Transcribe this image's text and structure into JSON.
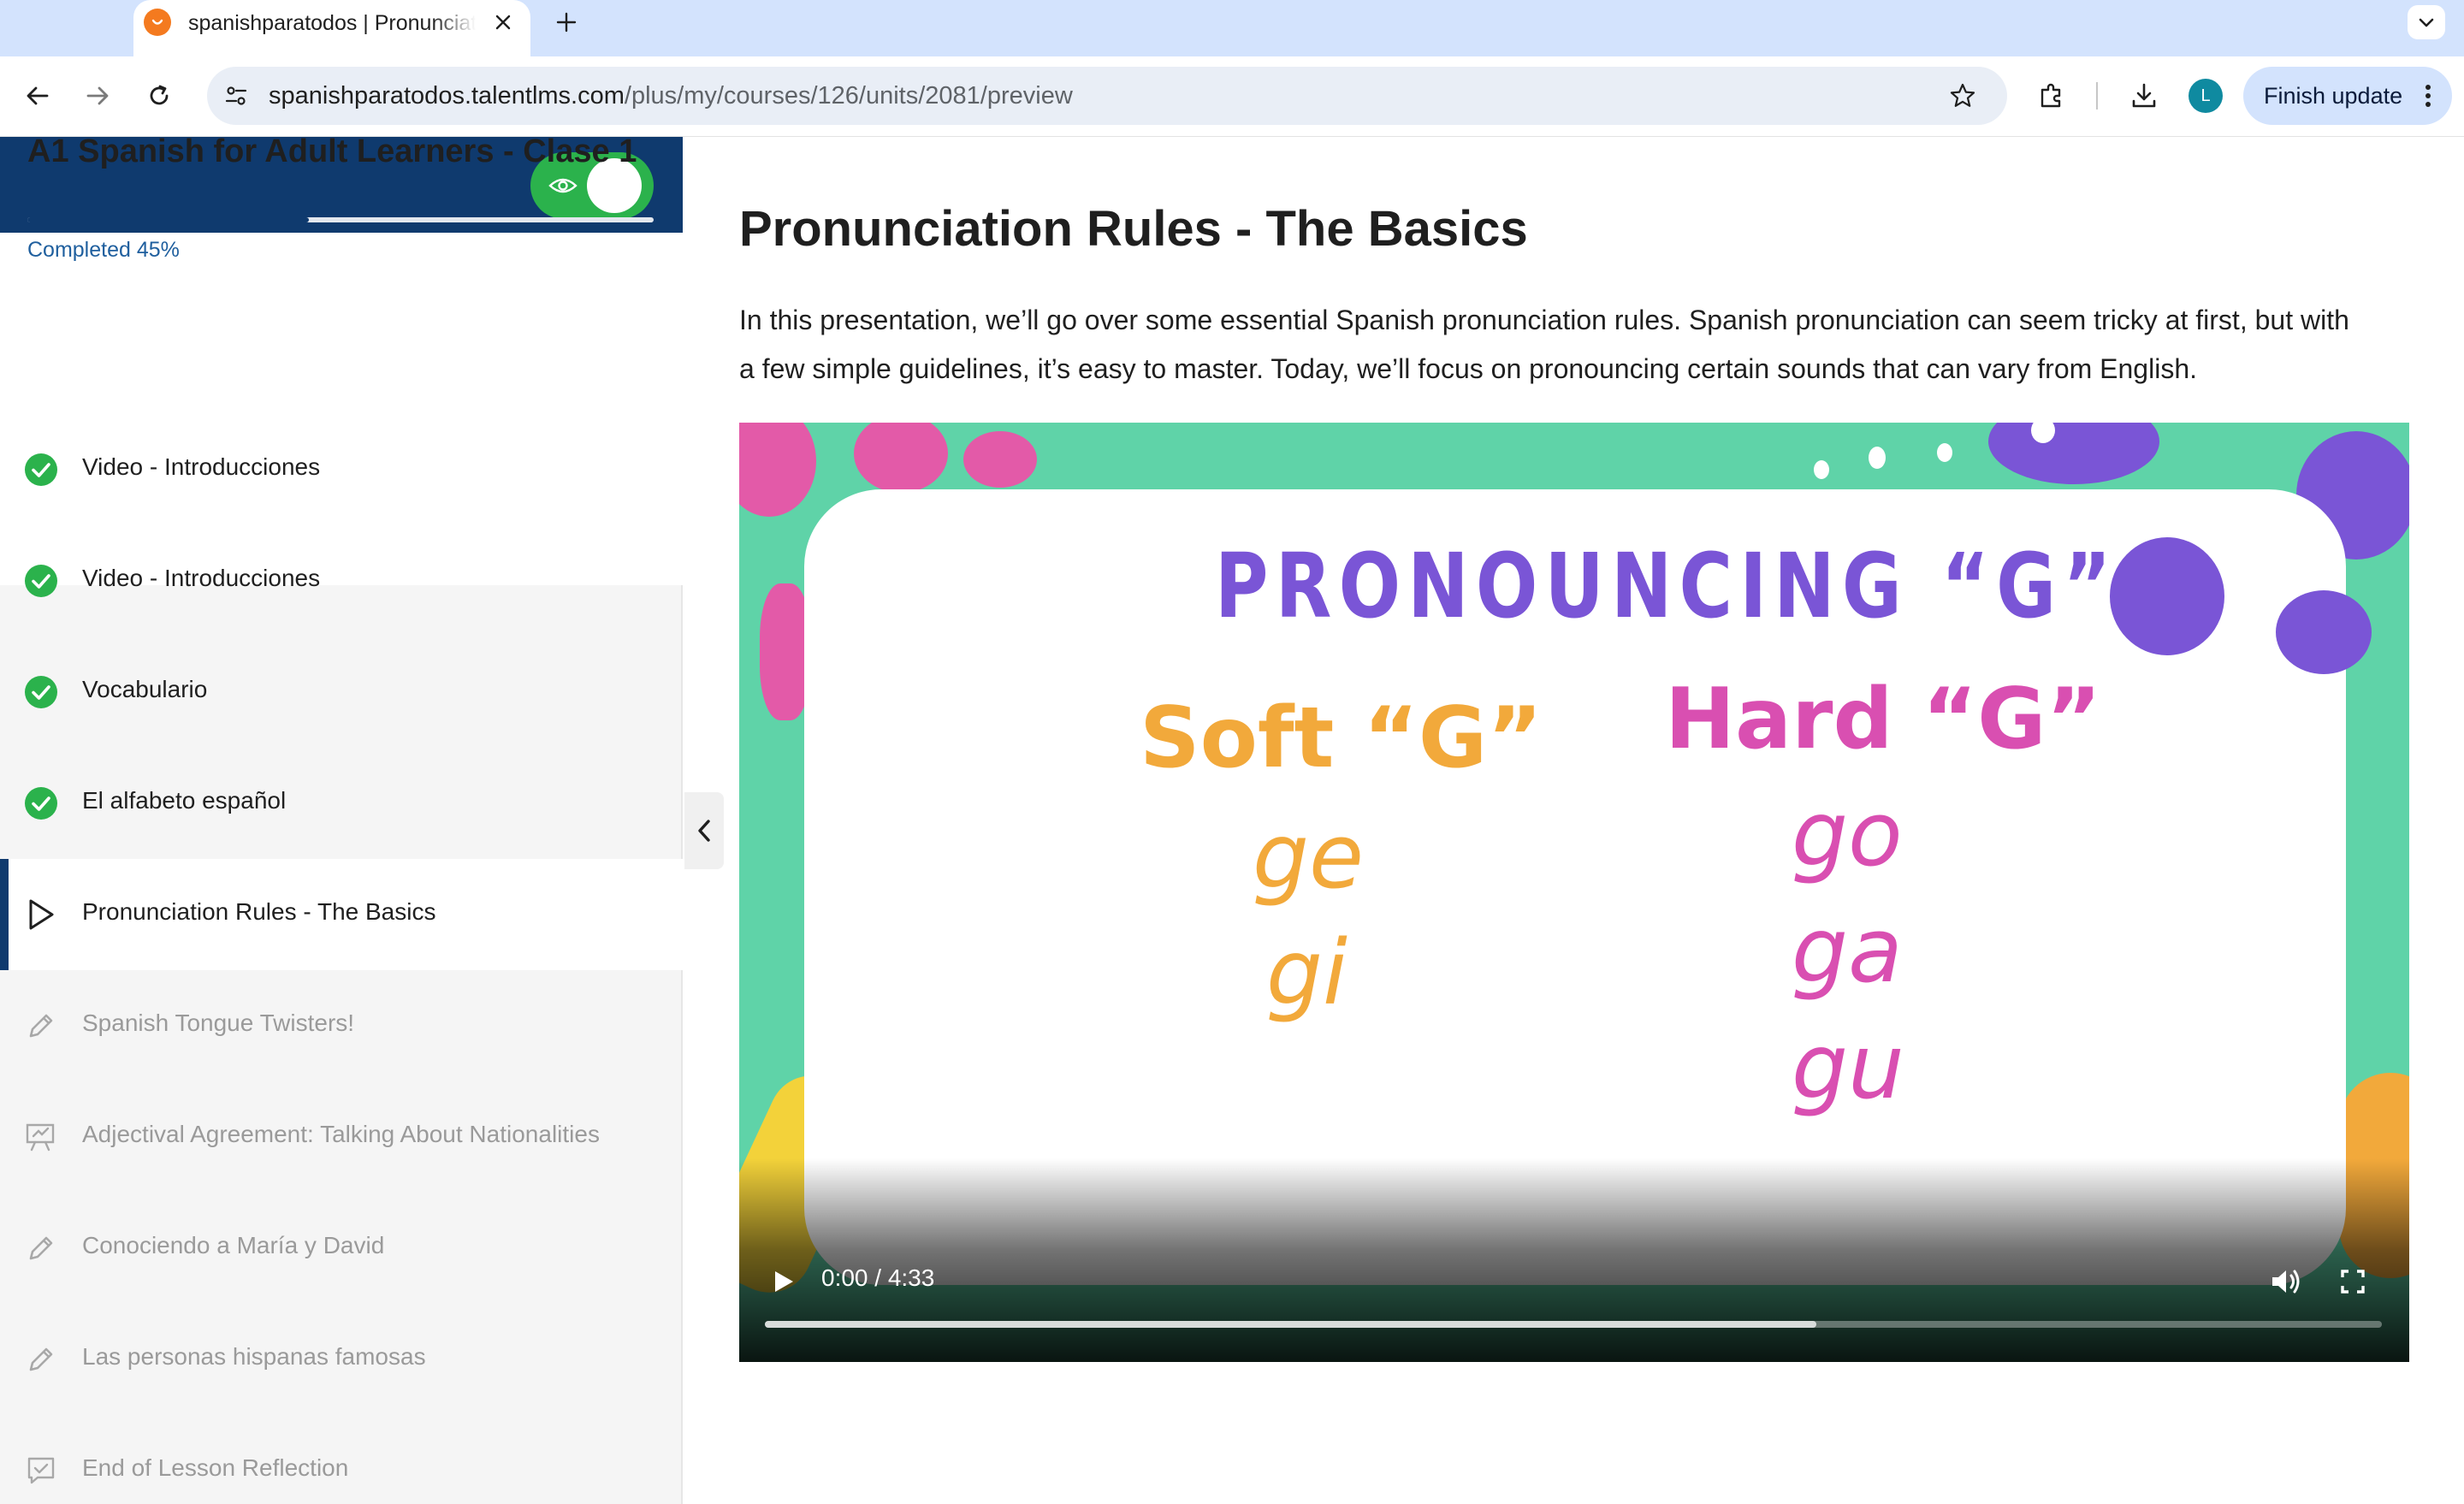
{
  "browser": {
    "tab_title": "spanishparatodos | Pronunciation Rules - The Basics",
    "url_host": "spanishparatodos.talentlms.com",
    "url_path": "/plus/my/courses/126/units/2081/preview",
    "profile_initial": "L",
    "finish_update_label": "Finish update"
  },
  "sidebar": {
    "course_title": "A1 Spanish for Adult Learners - Clase 1",
    "progress_label": "Completed 45%",
    "progress_fraction": 0.45,
    "units": [
      {
        "label": "Video - Introducciones",
        "status": "done",
        "icon": "check-circle-icon"
      },
      {
        "label": "Video - Introducciones",
        "status": "done",
        "icon": "check-circle-icon"
      },
      {
        "label": "Vocabulario",
        "status": "done",
        "icon": "check-circle-icon"
      },
      {
        "label": "El alfabeto español",
        "status": "done",
        "icon": "check-circle-icon"
      },
      {
        "label": "Pronunciation Rules - The Basics",
        "status": "active",
        "icon": "play-outline-icon"
      },
      {
        "label": "Spanish Tongue Twisters!",
        "status": "locked",
        "icon": "pencil-icon"
      },
      {
        "label": "Adjectival Agreement: Talking About Nationalities",
        "status": "locked",
        "icon": "presentation-icon"
      },
      {
        "label": "Conociendo a María y David",
        "status": "locked",
        "icon": "pencil-icon"
      },
      {
        "label": "Las personas hispanas famosas",
        "status": "locked",
        "icon": "pencil-icon"
      },
      {
        "label": "End of Lesson Reflection",
        "status": "locked",
        "icon": "survey-icon"
      }
    ]
  },
  "main": {
    "title": "Pronunciation Rules - The Basics",
    "description": "In this presentation, we’ll go over some essential Spanish pronunciation rules. Spanish pronunciation can seem tricky at first, but with a few simple guidelines, it’s easy to master. Today, we’ll focus on pronouncing certain sounds that can vary from English."
  },
  "video": {
    "slide_heading": "PRONOUNCING “G”",
    "soft_heading": "Soft “G”",
    "hard_heading": "Hard “G”",
    "soft_words": [
      "ge",
      "gi"
    ],
    "hard_words": [
      "go",
      "ga",
      "gu"
    ],
    "time": "0:00 / 4:33",
    "buffered_fraction": 0.65
  },
  "colors": {
    "brand_navy": "#0f3a6e",
    "toggle_green": "#2bb24c",
    "check_green": "#2bb24c",
    "slide_green": "#5fd3a8",
    "slide_purple": "#7a55d6",
    "slide_orange": "#f2a93b",
    "slide_pink": "#d94fb1"
  }
}
